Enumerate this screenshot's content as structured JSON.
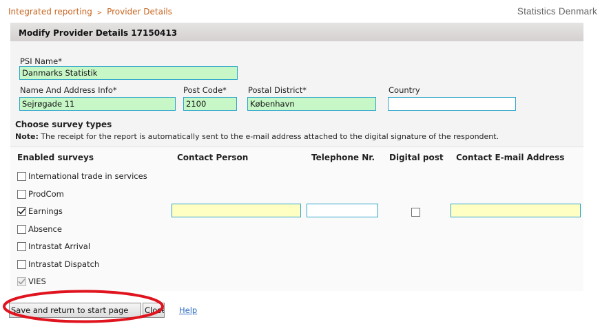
{
  "breadcrumb": {
    "home": "Integrated reporting",
    "separator": ">",
    "current": "Provider Details"
  },
  "brand": "Statistics Denmark",
  "panel": {
    "title": "Modify Provider Details 17150413"
  },
  "form": {
    "psi_name_label": "PSI Name*",
    "psi_name_value": "Danmarks Statistik",
    "address_label": "Name And Address Info*",
    "address_value": "Sejrøgade 11",
    "postcode_label": "Post Code*",
    "postcode_value": "2100",
    "district_label": "Postal District*",
    "district_value": "København",
    "country_label": "Country",
    "country_value": ""
  },
  "survey": {
    "title": "Choose survey types",
    "note_label": "Note:",
    "note_text": "The receipt for the report is automatically sent to the e-mail address attached to the digital signature of the respondent."
  },
  "table": {
    "headers": {
      "enabled": "Enabled surveys",
      "contact_person": "Contact Person",
      "telephone": "Telephone Nr.",
      "digital_post": "Digital post",
      "email": "Contact E-mail Address"
    },
    "rows": [
      {
        "label": "International trade in services",
        "checked": false,
        "disabled": false
      },
      {
        "label": "ProdCom",
        "checked": false,
        "disabled": false
      },
      {
        "label": "Earnings",
        "checked": true,
        "disabled": false
      },
      {
        "label": "Absence",
        "checked": false,
        "disabled": false
      },
      {
        "label": "Intrastat Arrival",
        "checked": false,
        "disabled": false
      },
      {
        "label": "Intrastat Dispatch",
        "checked": false,
        "disabled": false
      },
      {
        "label": "VIES",
        "checked": true,
        "disabled": true
      }
    ],
    "earnings_contact_person": "",
    "earnings_telephone": "",
    "earnings_digital_post": false,
    "earnings_email": ""
  },
  "buttons": {
    "save": "Save and return to start page",
    "close": "Close",
    "help": "Help"
  },
  "colors": {
    "breadcrumb": "#c8641e",
    "input_border": "#2aa4c9",
    "required_fill": "#c7f7c7",
    "survey_fill": "#ffffc4",
    "annotation": "#e0141e"
  },
  "icons": {
    "checkmark": "checkmark-icon",
    "breadcrumb_separator": "chevron-right-icon"
  }
}
